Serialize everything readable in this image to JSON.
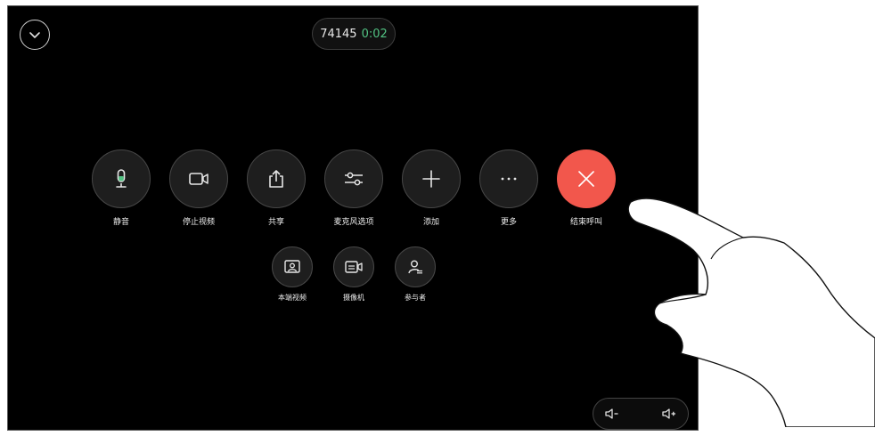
{
  "call": {
    "number": "74145",
    "duration": "0:02"
  },
  "controls": [
    {
      "label": "静音",
      "icon": "microphone-icon"
    },
    {
      "label": "停止视频",
      "icon": "video-camera-icon"
    },
    {
      "label": "共享",
      "icon": "share-icon"
    },
    {
      "label": "麦克风选项",
      "icon": "sliders-icon"
    },
    {
      "label": "添加",
      "icon": "plus-icon"
    },
    {
      "label": "更多",
      "icon": "more-icon"
    },
    {
      "label": "结束呼叫",
      "icon": "close-icon"
    }
  ],
  "secondary_controls": [
    {
      "label": "本端视频",
      "icon": "self-view-icon"
    },
    {
      "label": "摄像机",
      "icon": "camera-control-icon"
    },
    {
      "label": "参与者",
      "icon": "participants-icon"
    }
  ],
  "colors": {
    "end_call": "#f2574c",
    "timer": "#52c383",
    "mic_active": "#52c383",
    "background": "#000000"
  }
}
